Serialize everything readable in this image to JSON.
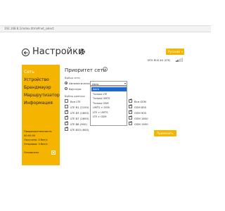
{
  "browser": {
    "url": "192.168.8.1/index.html#net_select"
  },
  "header": {
    "title": "Настройки",
    "language": "Русский",
    "operator": "MTS RUS 4G (LTE)"
  },
  "sidebar": {
    "items": [
      {
        "label": "Сеть",
        "active": true
      },
      {
        "label": "Устройство",
        "active": false
      },
      {
        "label": "Брандмауэр",
        "active": false
      },
      {
        "label": "Маршрутизатор",
        "active": false
      },
      {
        "label": "Информация",
        "active": false
      }
    ],
    "stats": {
      "duration_label": "Продолжительность:",
      "duration_value": "00:00:00",
      "received": "Получено: 0 бит/с",
      "sent": "Отправка: 0 бит/с",
      "disconnected": "Отключено"
    }
  },
  "main": {
    "section_title": "Приоритет сети",
    "select_network_label": "Выбор сети",
    "radio_auto": "Автоматически",
    "radio_manual": "Вручную",
    "select_value": "Авто",
    "range_label": "Выбор диапазо",
    "dropdown_options": [
      "Авто",
      "Только LTE",
      "Только UMTS",
      "Только GSM",
      "UMTS > GSM",
      "LTE > UMTS",
      "LTE > GSM"
    ],
    "lte_bands": [
      {
        "label": "Все LTE",
        "checked": false
      },
      {
        "label": "LTE B1 (2100)",
        "checked": false
      },
      {
        "label": "LTE B3 (1800)",
        "checked": true
      },
      {
        "label": "LTE B7 (2600)",
        "checked": true
      },
      {
        "label": "LTE B8 (900)",
        "checked": true
      },
      {
        "label": "LTE B20 (800)",
        "checked": true
      }
    ],
    "gsm_bands": [
      {
        "label": "Все GSM",
        "checked": true
      },
      {
        "label": "GSM 850",
        "checked": true
      },
      {
        "label": "GSM 900",
        "checked": true
      },
      {
        "label": "GSM 1800",
        "checked": true
      },
      {
        "label": "GSM 1900",
        "checked": true
      }
    ],
    "apply_label": "Применить"
  },
  "colors": {
    "accent": "#f4b400",
    "dropdown_highlight": "#1e66d0"
  }
}
